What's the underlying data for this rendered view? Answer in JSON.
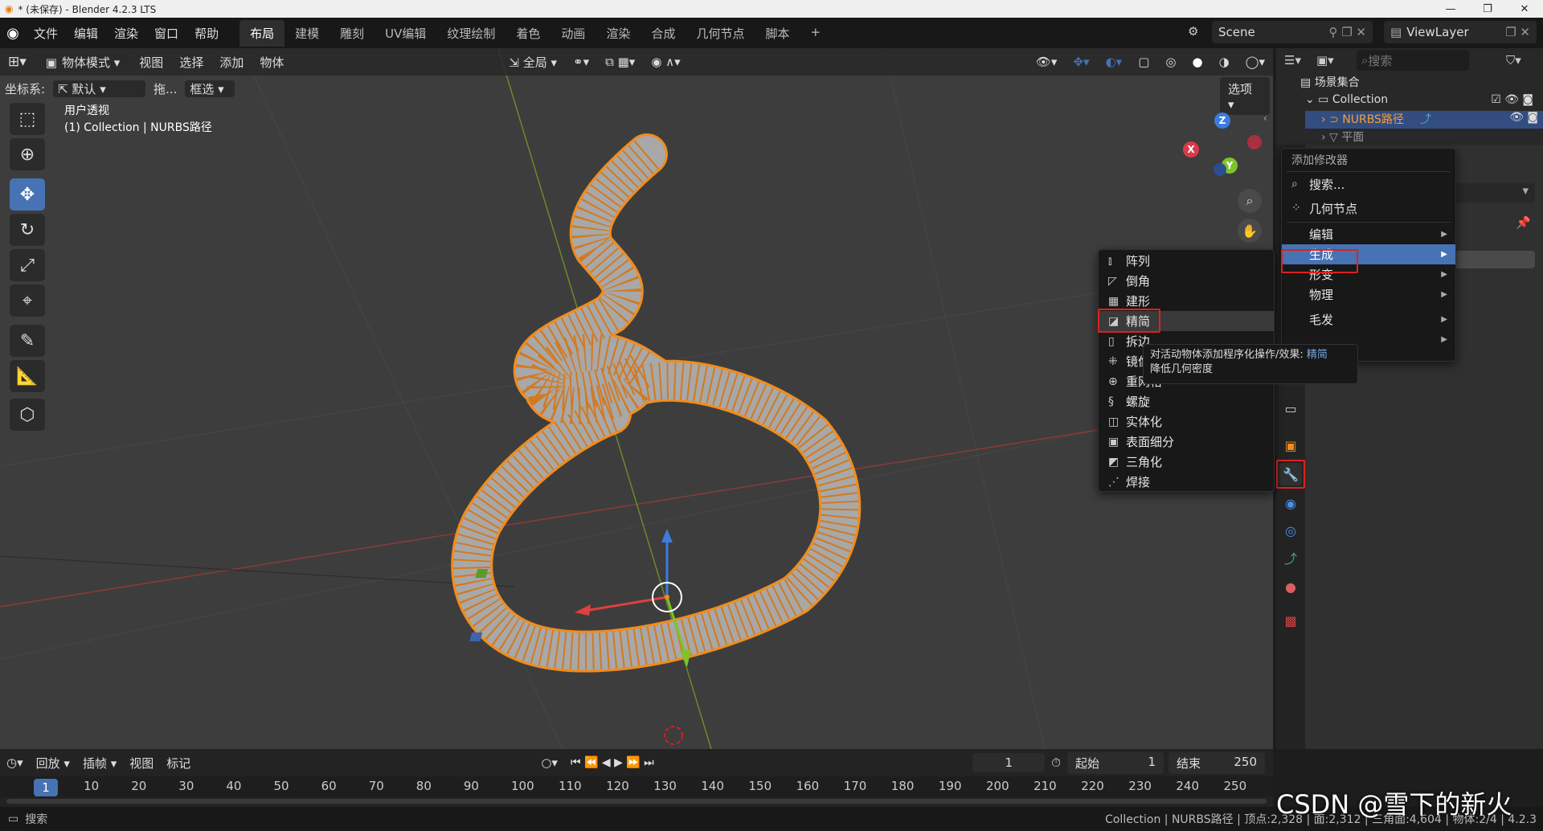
{
  "os": {
    "title": "* (未保存) - Blender 4.2.3 LTS",
    "min": "—",
    "max": "❐",
    "close": "✕"
  },
  "menubar": {
    "items": [
      "文件",
      "编辑",
      "渲染",
      "窗口",
      "帮助"
    ]
  },
  "workspaces": {
    "items": [
      "布局",
      "建模",
      "雕刻",
      "UV编辑",
      "纹理绘制",
      "着色",
      "动画",
      "渲染",
      "合成",
      "几何节点",
      "脚本"
    ],
    "active": "布局",
    "add": "+"
  },
  "scene": {
    "name": "Scene"
  },
  "viewlayer": {
    "name": "ViewLayer"
  },
  "viewport": {
    "mode": "物体模式",
    "menus": [
      "视图",
      "选择",
      "添加",
      "物体"
    ],
    "transform_orientation": "全局",
    "coord_label": "坐标系:",
    "coord_value": "默认",
    "drag_label": "拖...",
    "select_mode": "框选",
    "options": "选项",
    "view_name": "用户透视",
    "object_path": "(1) Collection | NURBS路径",
    "gizmo": {
      "x": "X",
      "y": "Y",
      "z": "Z"
    }
  },
  "outliner": {
    "search_placeholder": "搜索",
    "scene_collection": "场景集合",
    "collection": "Collection",
    "item1": "NURBS路径",
    "item2": "平面"
  },
  "add_modifier_menu": {
    "title": "添加修改器",
    "search": "搜索...",
    "geometry_nodes": "几何节点",
    "categories": [
      "编辑",
      "生成",
      "形变",
      "物理",
      "毛发"
    ],
    "highlighted": "生成"
  },
  "generate_submenu": {
    "items": [
      "阵列",
      "倒角",
      "建形",
      "精简",
      "拆边",
      "镜像",
      "重网格",
      "螺旋",
      "实体化",
      "表面细分",
      "三角化",
      "焊接"
    ],
    "highlighted": "精简"
  },
  "tooltip": {
    "line1_prefix": "对活动物体添加程序化操作/效果: ",
    "line1_name": "精简",
    "line2": "降低几何密度"
  },
  "timeline": {
    "menus": [
      "回放",
      "插帧",
      "视图",
      "标记"
    ],
    "current_frame": "1",
    "start_label": "起始",
    "start_value": "1",
    "end_label": "结束",
    "end_value": "250",
    "ruler": [
      "1",
      "10",
      "20",
      "30",
      "40",
      "50",
      "60",
      "70",
      "80",
      "90",
      "100",
      "110",
      "120",
      "130",
      "140",
      "150",
      "160",
      "170",
      "180",
      "190",
      "200",
      "210",
      "220",
      "230",
      "240",
      "250"
    ]
  },
  "status": {
    "search": "搜索",
    "stats": "Collection | NURBS路径 | 顶点:2,328 | 面:2,312 | 三角面:4,604 | 物体:2/4 | 4.2.3"
  },
  "watermark": "CSDN @雪下的新火",
  "colors": {
    "accent": "#4772b3",
    "selection_orange": "#f08c1e",
    "red_highlight": "#e02020"
  }
}
